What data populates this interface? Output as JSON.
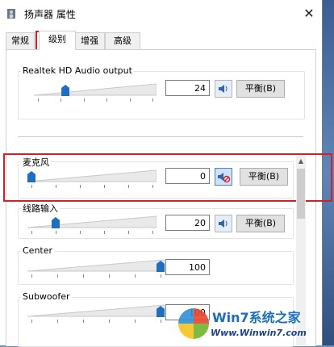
{
  "window": {
    "title": "扬声器 属性",
    "close_glyph": "✕"
  },
  "tabs": [
    {
      "label": "常规",
      "active": false
    },
    {
      "label": "级别",
      "active": true
    },
    {
      "label": "增强",
      "active": false
    },
    {
      "label": "高级",
      "active": false
    }
  ],
  "output": {
    "label": "Realtek HD Audio output",
    "value": "24",
    "level": 24,
    "balance_label": "平衡(B)"
  },
  "channels": [
    {
      "label": "麦克风",
      "value": "0",
      "level": 0,
      "muted": true,
      "balance_label": "平衡(B)"
    },
    {
      "label": "线路输入",
      "value": "20",
      "level": 20,
      "muted": false,
      "balance_label": "平衡(B)"
    },
    {
      "label": "Center",
      "value": "100",
      "level": 100
    },
    {
      "label": "Subwoofer",
      "value": "100",
      "level": 100
    }
  ],
  "colors": {
    "highlight": "#d0202a",
    "thumb": "#1f6fbf"
  },
  "watermark": {
    "brand": "Win7系统之家",
    "url": "Www.Winwin7.com"
  },
  "icons": {
    "app": "speaker-icon",
    "mute": "speaker-icon",
    "muted": "speaker-muted-icon"
  }
}
